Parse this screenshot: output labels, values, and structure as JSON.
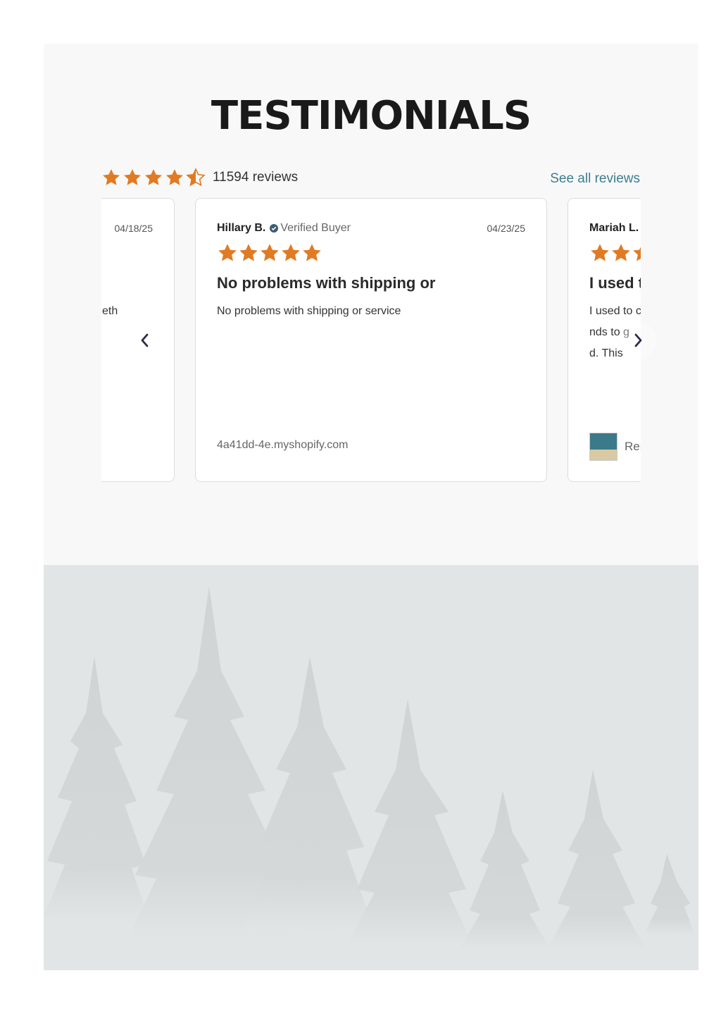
{
  "section": {
    "title": "TESTIMONIALS",
    "summary": {
      "rating": 4.5,
      "review_count_label": "11594 reviews",
      "see_all_label": "See all reviews"
    }
  },
  "colors": {
    "star": "#e07b24",
    "link": "#3d7d8f",
    "verified_badge": "#3b5c75",
    "arrow": "#2a2a4a"
  },
  "reviews": [
    {
      "date": "04/18/25",
      "body_partial": "eth"
    },
    {
      "author": "Hillary B.",
      "verified_label": "Verified Buyer",
      "date": "04/23/25",
      "rating": 5,
      "title": "No problems with shipping or",
      "body": "No problems with shipping or service",
      "source": "4a41dd-4e.myshopify.com"
    },
    {
      "author": "Mariah L.",
      "title": "I used t",
      "body_lines": [
        "I used to c",
        "nds to g",
        "d. This"
      ],
      "product_label": "Rer"
    }
  ],
  "icons": {
    "prev": "chevron-left-icon",
    "next": "chevron-right-icon",
    "verified": "check-circle-icon",
    "star": "star-icon"
  }
}
